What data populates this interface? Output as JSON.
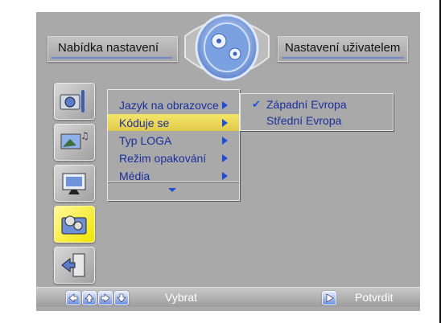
{
  "header": {
    "left_title": "Nabídka nastavení",
    "right_title": "Nastavení uživatelem",
    "emblem_icon": "gears-icon"
  },
  "sidebar": {
    "items": [
      {
        "icon": "camera-tools-icon",
        "selected": false
      },
      {
        "icon": "slideshow-music-icon",
        "selected": false
      },
      {
        "icon": "monitor-icon",
        "selected": false
      },
      {
        "icon": "setup-folder-icon",
        "selected": true
      },
      {
        "icon": "exit-door-icon",
        "selected": false
      }
    ]
  },
  "menu": {
    "items": [
      {
        "label": "Jazyk na obrazovce",
        "has_submenu": true,
        "selected": false
      },
      {
        "label": "Kóduje se",
        "has_submenu": true,
        "selected": true
      },
      {
        "label": "Typ LOGA",
        "has_submenu": true,
        "selected": false
      },
      {
        "label": "Režim opakování",
        "has_submenu": true,
        "selected": false
      },
      {
        "label": "Média",
        "has_submenu": true,
        "selected": false
      }
    ],
    "more_icon": "down-arrow-icon"
  },
  "submenu": {
    "items": [
      {
        "label": "Západní Evropa",
        "checked": true
      },
      {
        "label": "Střední Evropa",
        "checked": false
      }
    ]
  },
  "bottombar": {
    "select_hint": "Vybrat",
    "confirm_hint": "Potvrdit"
  },
  "colors": {
    "background": "#a9a9a9",
    "menu_text": "#1a2f9e",
    "highlight": "#e8d55a",
    "accent": "#1c4fd6"
  }
}
